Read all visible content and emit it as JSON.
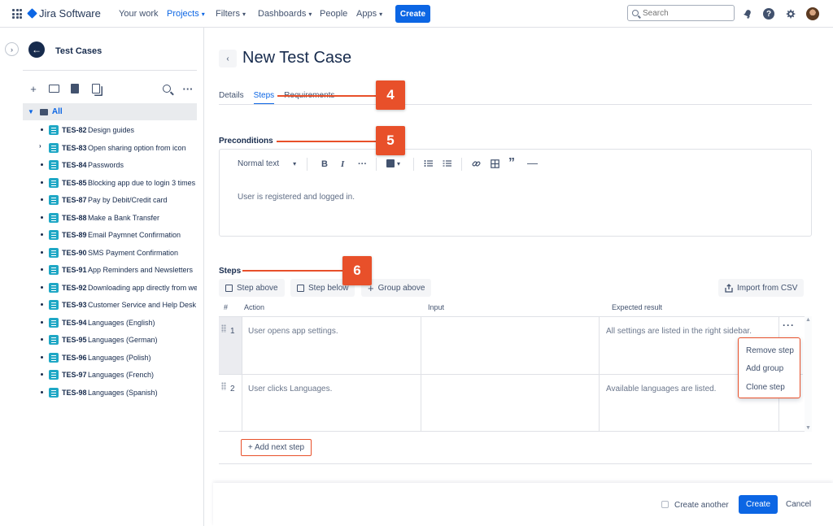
{
  "colors": {
    "accent": "#0c66e4",
    "annotation": "#e8502a",
    "test_case_icon": "#1ea7c5"
  },
  "topnav": {
    "app_name": "Jira Software",
    "items": [
      {
        "label": "Your work"
      },
      {
        "label": "Projects"
      },
      {
        "label": "Filters"
      },
      {
        "label": "Dashboards"
      },
      {
        "label": "People"
      },
      {
        "label": "Apps"
      }
    ],
    "create_label": "Create",
    "search_placeholder": "Search"
  },
  "sidebar": {
    "title": "Test Cases",
    "root_label": "All",
    "items": [
      {
        "key": "TES-82",
        "name": "Design guides"
      },
      {
        "key": "TES-83",
        "name": "Open sharing option from icon"
      },
      {
        "key": "TES-84",
        "name": "Passwords"
      },
      {
        "key": "TES-85",
        "name": "Blocking app due to login 3 times"
      },
      {
        "key": "TES-87",
        "name": "Pay by Debit/Credit card"
      },
      {
        "key": "TES-88",
        "name": "Make a Bank Transfer"
      },
      {
        "key": "TES-89",
        "name": "Email Paymnet Confirmation"
      },
      {
        "key": "TES-90",
        "name": "SMS Payment Confirmation"
      },
      {
        "key": "TES-91",
        "name": "App Reminders and Newsletters"
      },
      {
        "key": "TES-92",
        "name": "Downloading app directly from web"
      },
      {
        "key": "TES-93",
        "name": "Customer Service and Help Desk"
      },
      {
        "key": "TES-94",
        "name": "Languages (English)"
      },
      {
        "key": "TES-95",
        "name": "Languages (German)"
      },
      {
        "key": "TES-96",
        "name": "Languages (Polish)"
      },
      {
        "key": "TES-97",
        "name": "Languages (French)"
      },
      {
        "key": "TES-98",
        "name": "Languages (Spanish)"
      }
    ]
  },
  "main": {
    "title": "New Test Case",
    "tabs": [
      {
        "label": "Details"
      },
      {
        "label": "Steps"
      },
      {
        "label": "Requirements"
      }
    ],
    "preconditions": {
      "label": "Preconditions",
      "toolbar": {
        "text_style": "Normal text",
        "bold": "B",
        "italic": "I",
        "more": "···"
      },
      "content": "User is registered and logged in."
    },
    "steps": {
      "label": "Steps",
      "buttons": {
        "step_above": "Step above",
        "step_below": "Step below",
        "group_above": "Group above",
        "import_csv": "Import from CSV"
      },
      "columns": {
        "num": "#",
        "action": "Action",
        "input": "Input",
        "expected": "Expected result"
      },
      "rows": [
        {
          "num": "1",
          "action": "User opens app settings.",
          "input": "",
          "expected": "All settings are listed in the right sidebar."
        },
        {
          "num": "2",
          "action": "User clicks Languages.",
          "input": "",
          "expected": "Available languages are listed."
        }
      ],
      "menu": {
        "remove": "Remove step",
        "add_group": "Add group",
        "clone": "Clone step"
      },
      "add_next": "+ Add next step"
    }
  },
  "footer": {
    "create_another": "Create another",
    "create": "Create",
    "cancel": "Cancel"
  },
  "annotations": {
    "tabs": "4",
    "preconditions": "5",
    "steps": "6"
  }
}
